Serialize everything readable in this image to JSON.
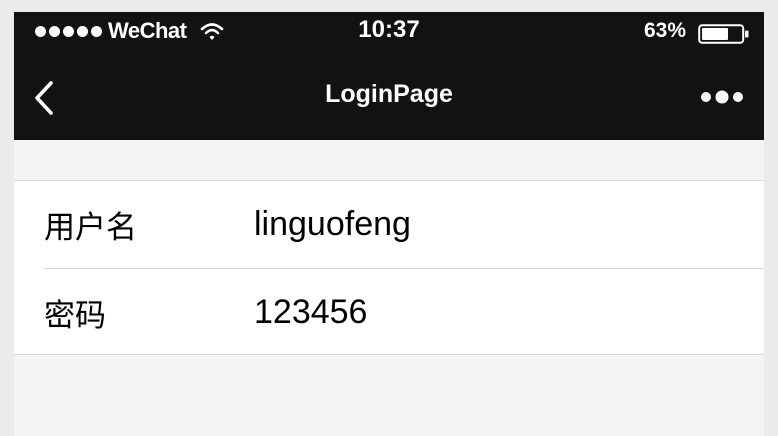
{
  "status_bar": {
    "carrier": "WeChat",
    "time": "10:37",
    "battery": "63%",
    "battery_level": 0.63
  },
  "nav": {
    "title": "LoginPage",
    "back_icon": "chevron-left-icon",
    "more_icon": "more-dots-icon"
  },
  "form": {
    "username": {
      "label": "用户名",
      "value": "linguofeng"
    },
    "password": {
      "label": "密码",
      "value": "123456"
    }
  },
  "colors": {
    "topbar": "#121212",
    "page_background": "#f4f4f4",
    "form_background": "#ffffff",
    "divider": "#d9d9d9"
  }
}
